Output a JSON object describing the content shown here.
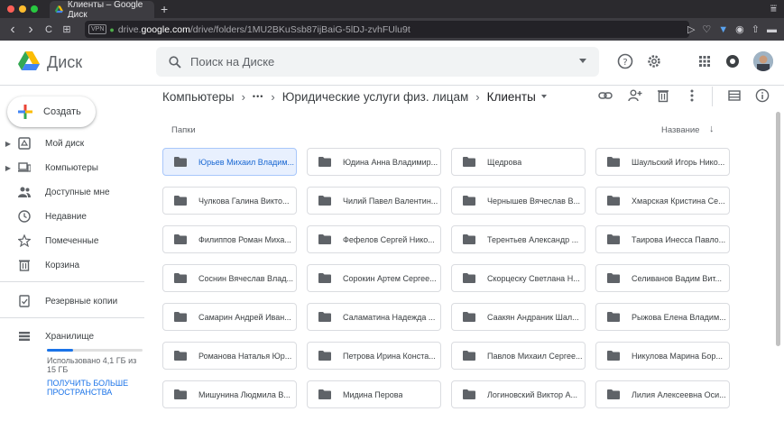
{
  "browser": {
    "tab_title": "Клиенты – Google Диск",
    "new_tab": "+",
    "tab_menu": "⩸",
    "vpn": "VPN",
    "url_prefix": "drive.",
    "url_host": "google.com",
    "url_path": "/drive/folders/1MU2BKuSsb87ijBaiG-5lDJ-zvhFUlu9t",
    "back": "‹",
    "forward": "›",
    "reload": "C",
    "apps": "⊞"
  },
  "header": {
    "logo_text": "Диск",
    "search_placeholder": "Поиск на Диске"
  },
  "sidebar": {
    "create_label": "Создать",
    "items": [
      {
        "label": "Мой диск",
        "icon": "my-drive-icon",
        "expandable": true
      },
      {
        "label": "Компьютеры",
        "icon": "computer-icon",
        "expandable": true
      },
      {
        "label": "Доступные мне",
        "icon": "shared-icon",
        "expandable": false
      },
      {
        "label": "Недавние",
        "icon": "clock-icon",
        "expandable": false
      },
      {
        "label": "Помеченные",
        "icon": "star-icon",
        "expandable": false
      },
      {
        "label": "Корзина",
        "icon": "trash-icon",
        "expandable": false
      }
    ],
    "backups_label": "Резервные копии",
    "storage_label": "Хранилище",
    "storage_used_text": "Использовано 4,1 ГБ из 15 ГБ",
    "storage_used_fraction": 0.27,
    "upgrade_label": "ПОЛУЧИТЬ БОЛЬШЕ ПРОСТРАНСТВА"
  },
  "breadcrumb": {
    "root": "Компьютеры",
    "ellipsis": "•••",
    "parent": "Юридические услуги физ. лицам",
    "current": "Клиенты",
    "separator": "›"
  },
  "content": {
    "section_label": "Папки",
    "sort_label": "Название",
    "sort_arrow": "↓",
    "folders": [
      "Юрьев Михаил Владим...",
      "Юдина Анна Владимир...",
      "Щедрова",
      "Шаульский Игорь Нико...",
      "Чулкова Галина Викто...",
      "Чилий Павел Валентин...",
      "Чернышев Вячеслав В...",
      "Хмарская Кристина Се...",
      "Филиппов Роман Миха...",
      "Фефелов Сергей Нико...",
      "Терентьев Александр ...",
      "Таирова Инесса Павло...",
      "Соснин Вячеслав Влад...",
      "Сорокин Артем Сергее...",
      "Скорцеску Светлана Н...",
      "Селиванов Вадим Вит...",
      "Самарин Андрей Иван...",
      "Саламатина Надежда ...",
      "Саакян Андраник Шал...",
      "Рыжова Елена Владим...",
      "Романова Наталья Юр...",
      "Петрова Ирина Конста...",
      "Павлов Михаил Сергее...",
      "Никулова Марина Бор...",
      "Мишунина Людмила В...",
      "Мидина Перова",
      "Логиновский Виктор А...",
      "Лилия Алексеевна Оси..."
    ],
    "selected_index": 0
  },
  "colors": {
    "accent": "#1a73e8",
    "selected_bg": "#e8f0fe",
    "folder_icon": "#5f6368"
  }
}
